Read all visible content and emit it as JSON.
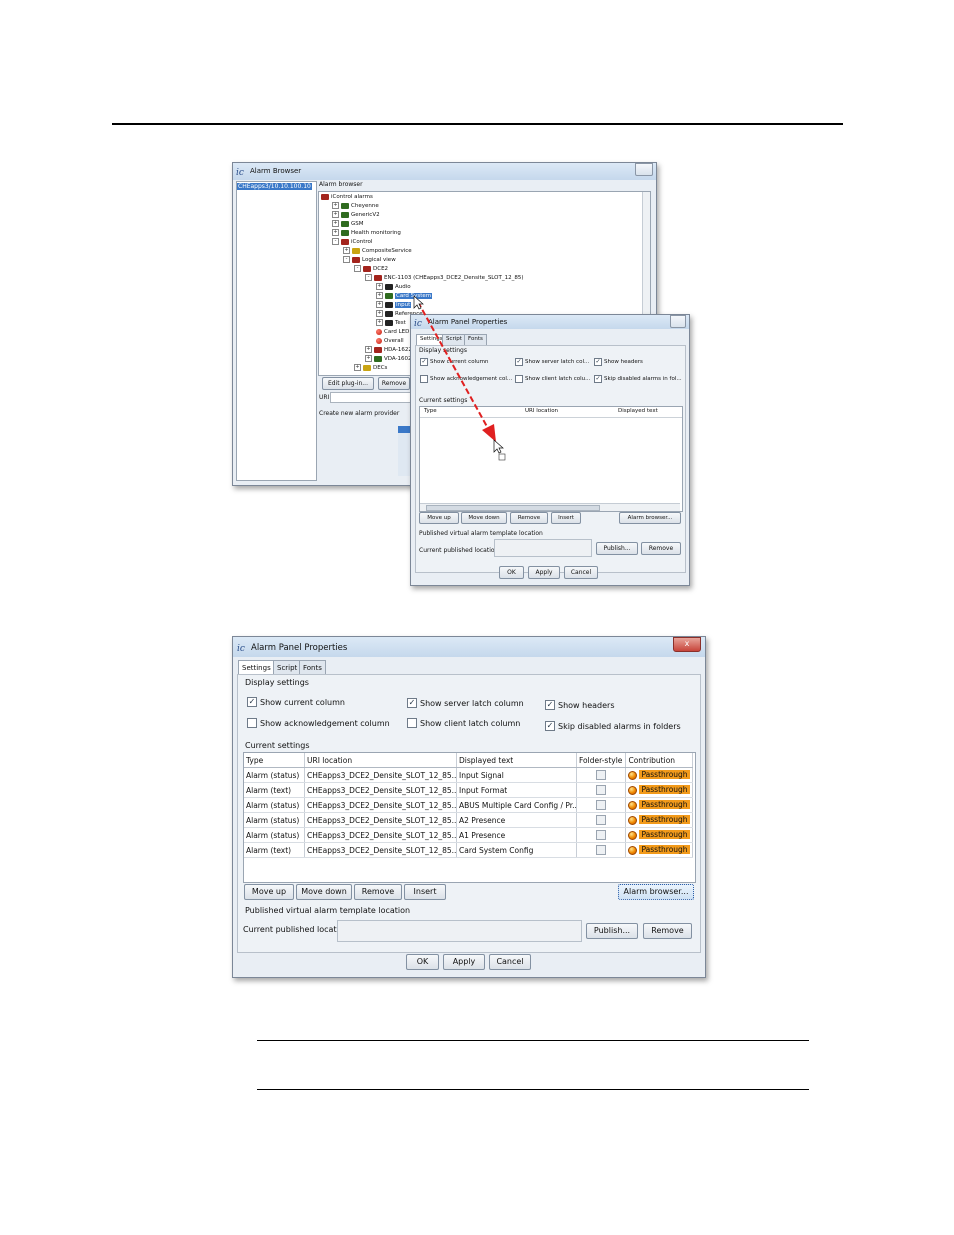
{
  "top_alarm_browser": {
    "title": "Alarm Browser",
    "server": "CHEapps3/10.10.100.10",
    "panel_label": "Alarm browser",
    "tree": [
      {
        "label": "iControl alarms",
        "depth": 0,
        "folder": "red",
        "expander": ""
      },
      {
        "label": "Cheyenne",
        "depth": 1,
        "folder": "green",
        "expander": "+"
      },
      {
        "label": "GenericV2",
        "depth": 1,
        "folder": "green",
        "expander": "+"
      },
      {
        "label": "GSM",
        "depth": 1,
        "folder": "green",
        "expander": "+"
      },
      {
        "label": "Health monitoring",
        "depth": 1,
        "folder": "green",
        "expander": "+"
      },
      {
        "label": "iControl",
        "depth": 1,
        "folder": "red",
        "expander": "-"
      },
      {
        "label": "CompositeService",
        "depth": 2,
        "folder": "yellow",
        "expander": "+"
      },
      {
        "label": "Logical view",
        "depth": 2,
        "folder": "red",
        "expander": "-"
      },
      {
        "label": "DCE2",
        "depth": 3,
        "folder": "red",
        "expander": "-"
      },
      {
        "label": "ENC-1103 (CHEapps3_DCE2_Densite_SLOT_12_85)",
        "depth": 4,
        "folder": "red",
        "expander": "-"
      },
      {
        "label": "Audio",
        "depth": 5,
        "folder": "black",
        "expander": "+"
      },
      {
        "label": "Card System",
        "depth": 5,
        "folder": "green",
        "expander": "+",
        "selected": true
      },
      {
        "label": "Input",
        "depth": 5,
        "folder": "black",
        "expander": "+",
        "selected": true
      },
      {
        "label": "Reference",
        "depth": 5,
        "folder": "black",
        "expander": "+"
      },
      {
        "label": "Test",
        "depth": 5,
        "folder": "black",
        "expander": "+"
      },
      {
        "label": "Card LED",
        "depth": 5,
        "folder": "dot",
        "expander": ""
      },
      {
        "label": "Overall",
        "depth": 5,
        "folder": "dot",
        "expander": ""
      },
      {
        "label": "HDA-1622 (CH",
        "depth": 4,
        "folder": "red",
        "expander": "+"
      },
      {
        "label": "VDA-1602 (CH",
        "depth": 4,
        "folder": "green",
        "expander": "+"
      },
      {
        "label": "DECs",
        "depth": 3,
        "folder": "yellow",
        "expander": "+"
      }
    ],
    "edit_plugin_label": "Edit plug-in...",
    "remove_label": "Remove p",
    "uri_label": "URI",
    "create_label": "Create new alarm provider"
  },
  "top_panel_properties": {
    "title": "Alarm Panel Properties",
    "tabs": [
      "Settings",
      "Script",
      "Fonts"
    ],
    "display_settings_label": "Display settings",
    "checkboxes": [
      {
        "label": "Show current column",
        "checked": true
      },
      {
        "label": "Show server latch col...",
        "checked": true
      },
      {
        "label": "Show headers",
        "checked": true
      },
      {
        "label": "Show acknowledgement col...",
        "checked": false
      },
      {
        "label": "Show client latch colu...",
        "checked": false
      },
      {
        "label": "Skip disabled alarms in fol...",
        "checked": true
      }
    ],
    "current_settings_label": "Current settings",
    "columns": [
      "Type",
      "URI location",
      "Displayed text"
    ],
    "buttons": [
      "Move up",
      "Move down",
      "Remove",
      "Insert",
      "Alarm browser..."
    ],
    "published_label": "Published virtual alarm template location",
    "current_published_label": "Current published location:",
    "publish_label": "Publish...",
    "remove2_label": "Remove",
    "ok_label": "OK",
    "apply_label": "Apply",
    "cancel_label": "Cancel",
    "arrow_color": "#e02020"
  },
  "dialog": {
    "title": "Alarm Panel Properties",
    "tabs": [
      "Settings",
      "Script",
      "Fonts"
    ],
    "display_settings_label": "Display settings",
    "checkboxes": [
      {
        "label": "Show current column",
        "checked": true
      },
      {
        "label": "Show server latch column",
        "checked": true
      },
      {
        "label": "Show headers",
        "checked": true
      },
      {
        "label": "Show acknowledgement column",
        "checked": false
      },
      {
        "label": "Show client latch column",
        "checked": false
      },
      {
        "label": "Skip disabled alarms in folders",
        "checked": true
      }
    ],
    "current_settings_label": "Current settings",
    "columns": [
      "Type",
      "URI location",
      "Displayed text",
      "Folder-style",
      "Contribution"
    ],
    "rows": [
      {
        "type": "Alarm (status)",
        "uri": "CHEapps3_DCE2_Densite_SLOT_12_85...",
        "text": "Input Signal",
        "folder_style": false,
        "contribution": "Passthrough"
      },
      {
        "type": "Alarm (text)",
        "uri": "CHEapps3_DCE2_Densite_SLOT_12_85...",
        "text": "Input Format",
        "folder_style": false,
        "contribution": "Passthrough"
      },
      {
        "type": "Alarm (status)",
        "uri": "CHEapps3_DCE2_Densite_SLOT_12_85...",
        "text": "ABUS Multiple Card Config / Pr...",
        "folder_style": false,
        "contribution": "Passthrough"
      },
      {
        "type": "Alarm (status)",
        "uri": "CHEapps3_DCE2_Densite_SLOT_12_85...",
        "text": "A2 Presence",
        "folder_style": false,
        "contribution": "Passthrough"
      },
      {
        "type": "Alarm (status)",
        "uri": "CHEapps3_DCE2_Densite_SLOT_12_85...",
        "text": "A1 Presence",
        "folder_style": false,
        "contribution": "Passthrough"
      },
      {
        "type": "Alarm (text)",
        "uri": "CHEapps3_DCE2_Densite_SLOT_12_85...",
        "text": "Card System Config",
        "folder_style": false,
        "contribution": "Passthrough"
      }
    ],
    "move_up_label": "Move up",
    "move_down_label": "Move down",
    "remove_label": "Remove",
    "insert_label": "Insert",
    "alarm_browser_label": "Alarm browser...",
    "published_label": "Published virtual alarm template location",
    "current_published_label": "Current published location:",
    "publish_label": "Publish...",
    "remove2_label": "Remove",
    "ok_label": "OK",
    "apply_label": "Apply",
    "cancel_label": "Cancel",
    "close_label": "x"
  }
}
